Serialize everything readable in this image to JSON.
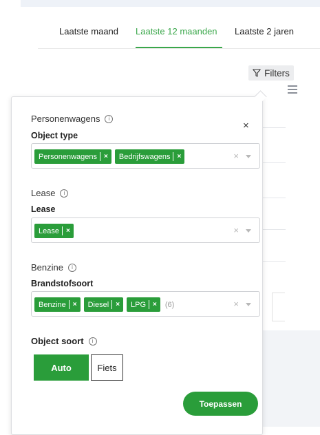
{
  "tabs": [
    {
      "label": "Laatste maand",
      "active": false
    },
    {
      "label": "Laatste 12 maanden",
      "active": true
    },
    {
      "label": "Laatste 2 jaren",
      "active": false
    }
  ],
  "toolbar": {
    "filters_label": "Filters",
    "filter_icon": "funnel-icon",
    "menu_icon": "hamburger-icon"
  },
  "panel": {
    "close_label": "×",
    "sections": [
      {
        "title": "Personenwagens",
        "label": "Object type",
        "chips": [
          "Personenwagens",
          "Bedrijfswagens"
        ],
        "more": ""
      },
      {
        "title": "Lease",
        "label": "Lease",
        "chips": [
          "Lease"
        ],
        "more": ""
      },
      {
        "title": "Benzine",
        "label": "Brandstofsoort",
        "chips": [
          "Benzine",
          "Diesel",
          "LPG"
        ],
        "more": "(6)"
      }
    ],
    "object_soort": {
      "label": "Object soort",
      "options": [
        "Auto",
        "Fiets"
      ],
      "selected": "Auto"
    },
    "apply_label": "Toepassen",
    "chip_remove": "×",
    "clear_label": "×",
    "info_glyph": "i"
  },
  "colors": {
    "accent": "#2a9d3a",
    "active_tab": "#3aa74a"
  }
}
